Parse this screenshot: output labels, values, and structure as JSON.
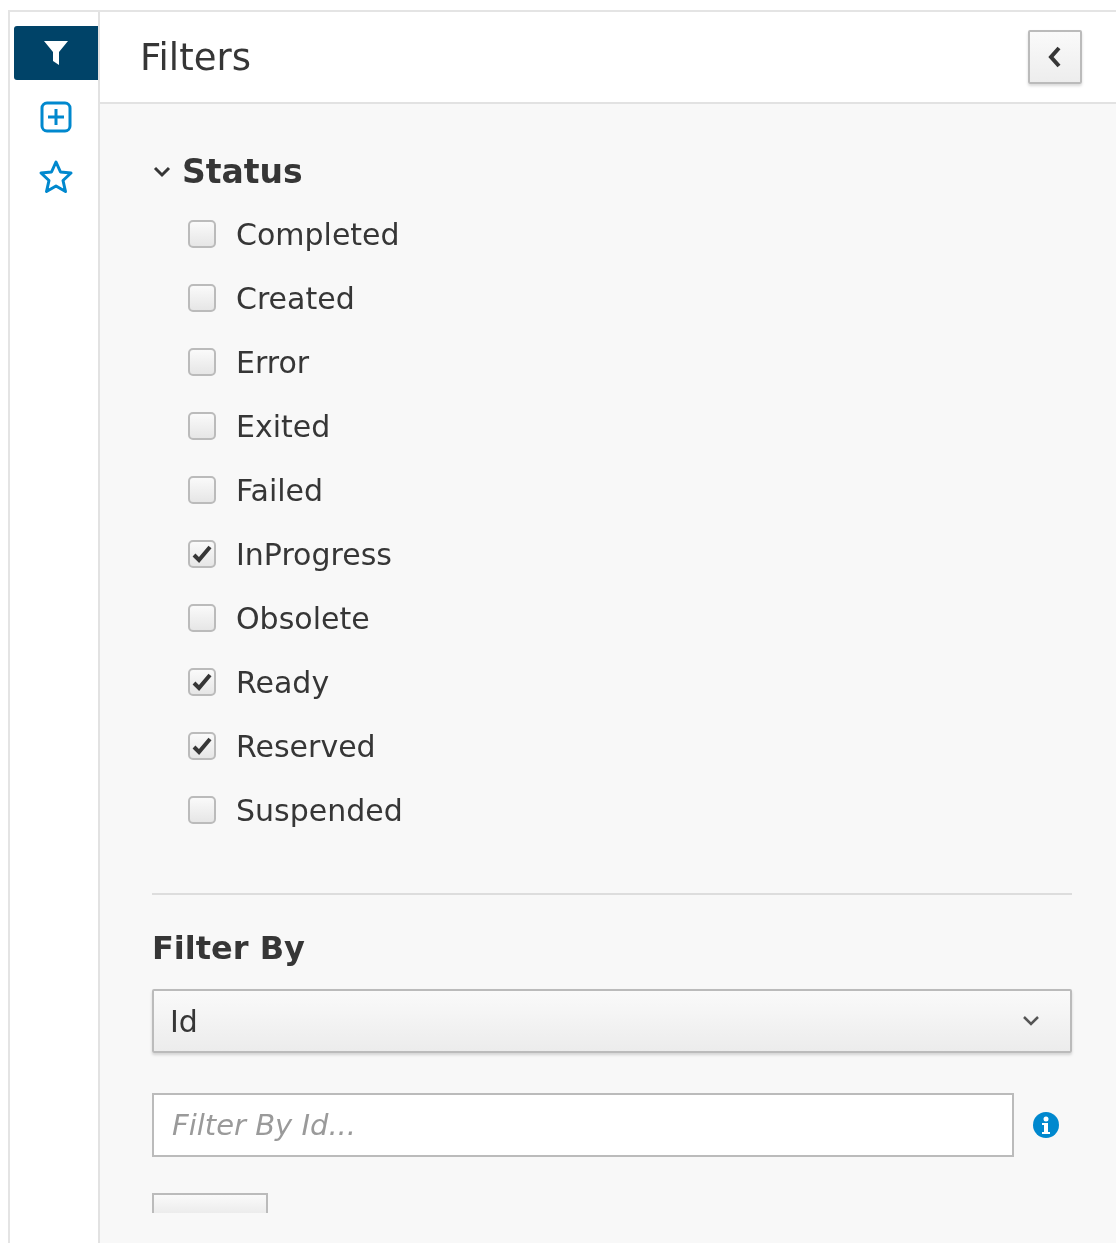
{
  "rail": [
    {
      "kind": "filter",
      "selected": true
    },
    {
      "kind": "add",
      "selected": false
    },
    {
      "kind": "star",
      "selected": false
    }
  ],
  "header": {
    "title": "Filters"
  },
  "status": {
    "title": "Status",
    "expanded": true,
    "options": [
      {
        "label": "Completed",
        "checked": false
      },
      {
        "label": "Created",
        "checked": false
      },
      {
        "label": "Error",
        "checked": false
      },
      {
        "label": "Exited",
        "checked": false
      },
      {
        "label": "Failed",
        "checked": false
      },
      {
        "label": "InProgress",
        "checked": true
      },
      {
        "label": "Obsolete",
        "checked": false
      },
      {
        "label": "Ready",
        "checked": true
      },
      {
        "label": "Reserved",
        "checked": true
      },
      {
        "label": "Suspended",
        "checked": false
      }
    ]
  },
  "filter_by": {
    "title": "Filter By",
    "select": {
      "value": "Id"
    },
    "input": {
      "placeholder": "Filter By Id..."
    }
  }
}
